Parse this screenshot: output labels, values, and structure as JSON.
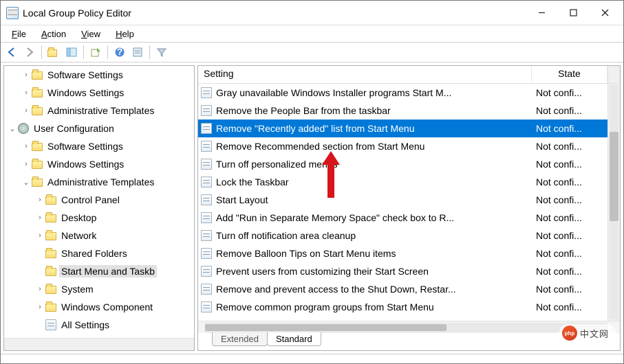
{
  "window": {
    "title": "Local Group Policy Editor"
  },
  "menu": {
    "items": [
      "File",
      "Action",
      "View",
      "Help"
    ]
  },
  "toolbar": {
    "back": "back-icon",
    "forward": "forward-icon",
    "up_folder": "up-folder-icon",
    "show_hide": "show-hide-tree-icon",
    "export": "export-list-icon",
    "help": "help-icon",
    "properties": "properties-icon",
    "filter": "filter-icon"
  },
  "tree": [
    {
      "level": 1,
      "exp": ">",
      "icon": "folder",
      "label": "Software Settings"
    },
    {
      "level": 1,
      "exp": ">",
      "icon": "folder",
      "label": "Windows Settings"
    },
    {
      "level": 1,
      "exp": ">",
      "icon": "folder",
      "label": "Administrative Templates"
    },
    {
      "level": 0,
      "exp": "v",
      "icon": "gear",
      "label": "User Configuration"
    },
    {
      "level": 1,
      "exp": ">",
      "icon": "folder",
      "label": "Software Settings"
    },
    {
      "level": 1,
      "exp": ">",
      "icon": "folder",
      "label": "Windows Settings"
    },
    {
      "level": 1,
      "exp": "v",
      "icon": "folder",
      "label": "Administrative Templates"
    },
    {
      "level": 2,
      "exp": ">",
      "icon": "folder",
      "label": "Control Panel"
    },
    {
      "level": 2,
      "exp": ">",
      "icon": "folder",
      "label": "Desktop"
    },
    {
      "level": 2,
      "exp": ">",
      "icon": "folder",
      "label": "Network"
    },
    {
      "level": 2,
      "exp": "",
      "icon": "folder",
      "label": "Shared Folders"
    },
    {
      "level": 2,
      "exp": "",
      "icon": "folder",
      "label": "Start Menu and Taskb",
      "selected": true
    },
    {
      "level": 2,
      "exp": ">",
      "icon": "folder",
      "label": "System"
    },
    {
      "level": 2,
      "exp": ">",
      "icon": "folder",
      "label": "Windows Component"
    },
    {
      "level": 2,
      "exp": "",
      "icon": "setting",
      "label": "All Settings"
    }
  ],
  "list": {
    "columns": {
      "setting": "Setting",
      "state": "State"
    },
    "rows": [
      {
        "label": "Gray unavailable Windows Installer programs Start M...",
        "state": "Not confi..."
      },
      {
        "label": "Remove the People Bar from the taskbar",
        "state": "Not confi..."
      },
      {
        "label": "Remove \"Recently added\" list from Start Menu",
        "state": "Not confi...",
        "selected": true
      },
      {
        "label": "Remove Recommended section from Start Menu",
        "state": "Not confi..."
      },
      {
        "label": "Turn off personalized menus",
        "state": "Not confi..."
      },
      {
        "label": "Lock the Taskbar",
        "state": "Not confi..."
      },
      {
        "label": "Start Layout",
        "state": "Not confi..."
      },
      {
        "label": "Add \"Run in Separate Memory Space\" check box to R...",
        "state": "Not confi..."
      },
      {
        "label": "Turn off notification area cleanup",
        "state": "Not confi..."
      },
      {
        "label": "Remove Balloon Tips on Start Menu items",
        "state": "Not confi..."
      },
      {
        "label": "Prevent users from customizing their Start Screen",
        "state": "Not confi..."
      },
      {
        "label": "Remove and prevent access to the Shut Down, Restar...",
        "state": "Not confi..."
      },
      {
        "label": "Remove common program groups from Start Menu",
        "state": "Not confi..."
      }
    ]
  },
  "tabs": {
    "extended": "Extended",
    "standard": "Standard"
  },
  "watermark": {
    "logo_text": "php",
    "label": "中文网"
  }
}
